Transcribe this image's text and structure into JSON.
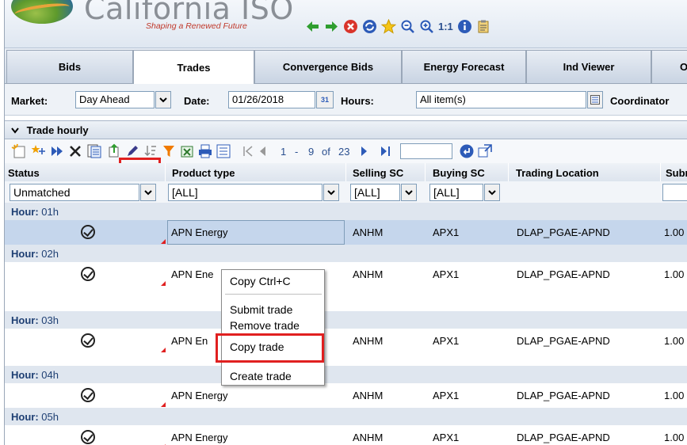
{
  "header": {
    "logo_title": "California ISO",
    "logo_tagline": "Shaping a Renewed Future",
    "zoom_label": "1:1"
  },
  "tabs": [
    {
      "label": "Bids"
    },
    {
      "label": "Trades"
    },
    {
      "label": "Convergence Bids"
    },
    {
      "label": "Energy Forecast"
    },
    {
      "label": "Ind Viewer"
    },
    {
      "label": "O"
    }
  ],
  "filters": {
    "market_label": "Market:",
    "market_value": "Day Ahead",
    "date_label": "Date:",
    "date_value": "01/26/2018",
    "calendar_label": "31",
    "hours_label": "Hours:",
    "hours_value": "All item(s)",
    "coordinator_label": "Coordinator"
  },
  "panel": {
    "title": "Trade hourly"
  },
  "pager": {
    "start": "1",
    "dash": "-",
    "end": "9",
    "of": "of",
    "total": "23"
  },
  "table": {
    "columns": [
      "Status",
      "Product type",
      "Selling SC",
      "Buying SC",
      "Trading Location",
      "Subr"
    ],
    "filter_values": {
      "status": "Unmatched",
      "product": "[ALL]",
      "selling": "[ALL]",
      "buying": "[ALL]"
    },
    "hours": [
      {
        "label": "Hour:",
        "value": "01h"
      },
      {
        "label": "Hour:",
        "value": "02h"
      },
      {
        "label": "Hour:",
        "value": "03h"
      },
      {
        "label": "Hour:",
        "value": "04h"
      },
      {
        "label": "Hour:",
        "value": "05h"
      }
    ],
    "rows": [
      {
        "product": "APN Energy",
        "selling": "ANHM",
        "buying": "APX1",
        "location": "DLAP_PGAE-APND",
        "sub": "1.00"
      },
      {
        "product": "APN Ene",
        "selling": "ANHM",
        "buying": "APX1",
        "location": "DLAP_PGAE-APND",
        "sub": "1.00"
      },
      {
        "product": "APN En",
        "selling": "ANHM",
        "buying": "APX1",
        "location": "DLAP_PGAE-APND",
        "sub": "1.00"
      },
      {
        "product": "APN Energy",
        "selling": "ANHM",
        "buying": "APX1",
        "location": "DLAP_PGAE-APND",
        "sub": "1.00"
      },
      {
        "product": "APN Energy",
        "selling": "ANHM",
        "buying": "APX1",
        "location": "DLAP_PGAE-APND",
        "sub": "1.00"
      }
    ]
  },
  "context_menu": {
    "copy": "Copy  Ctrl+C",
    "submit": "Submit trade",
    "remove": "Remove trade",
    "copy_trade": "Copy trade",
    "create": "Create trade"
  },
  "colors": {
    "highlight": "#e02020",
    "selected_row": "#c5d6ec",
    "hour_row": "#dfe6ef"
  }
}
